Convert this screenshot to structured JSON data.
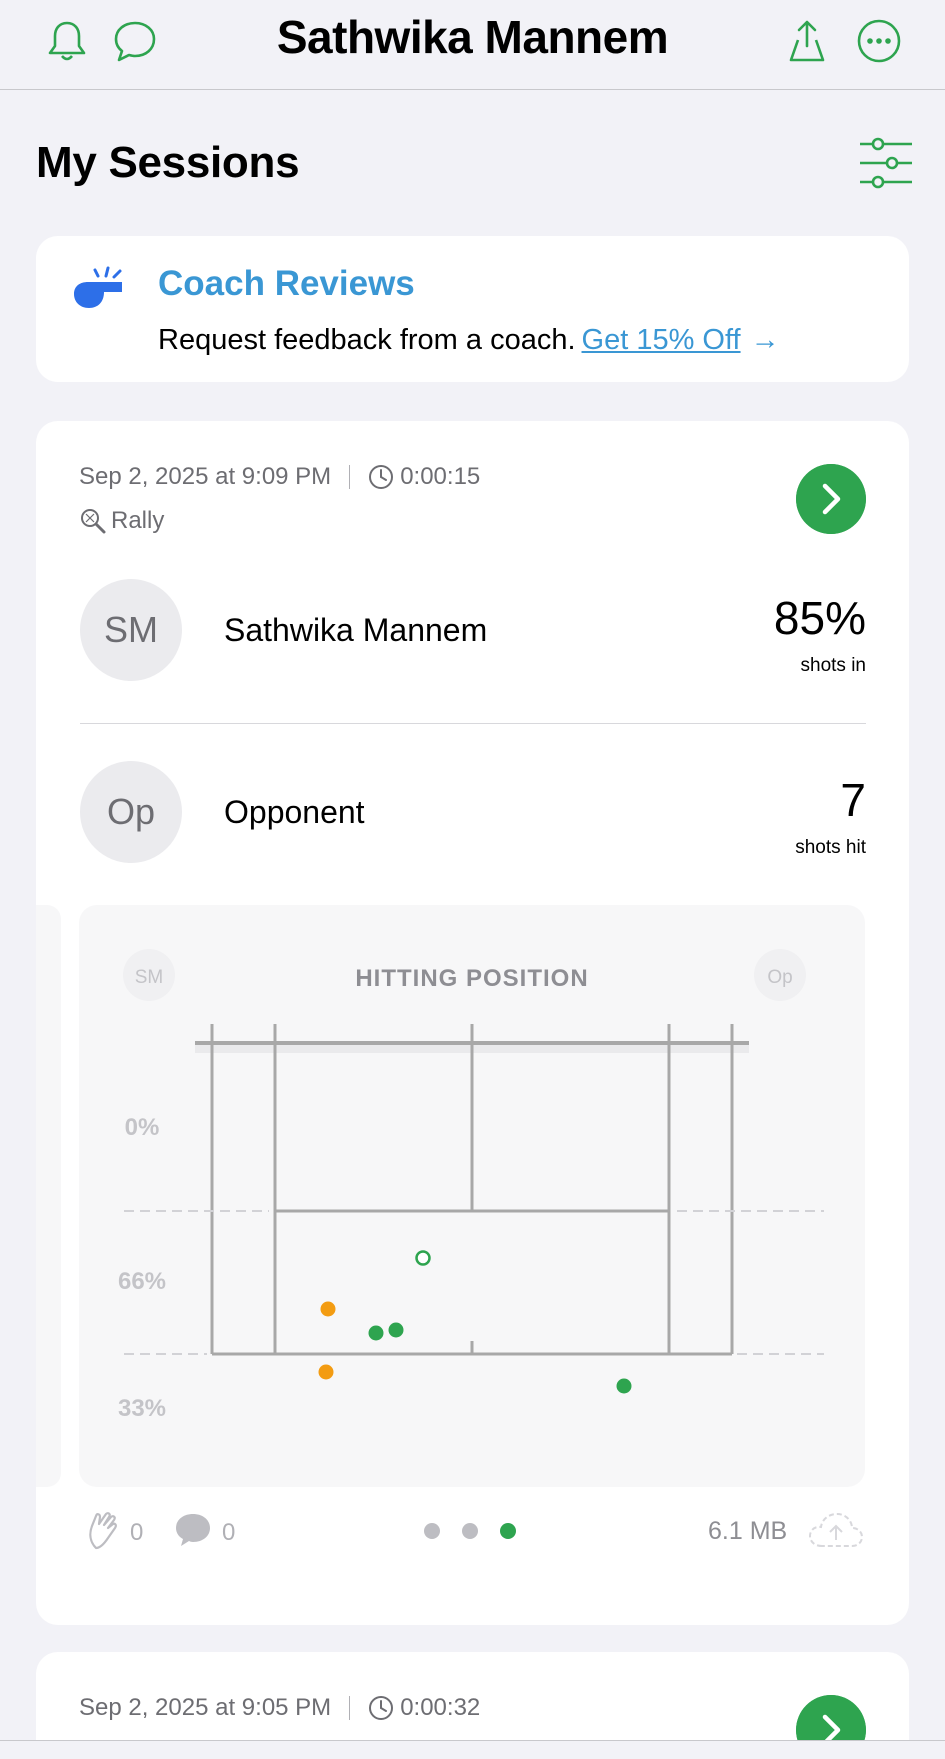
{
  "header": {
    "title": "Sathwika Mannem",
    "icons": [
      "bell-icon",
      "chat-bubble-icon",
      "share-icon",
      "more-icon"
    ]
  },
  "section": {
    "title": "My Sessions"
  },
  "coach": {
    "title": "Coach Reviews",
    "subtitle": "Request feedback from a coach.",
    "link": "Get 15% Off",
    "arrow": "→"
  },
  "session1": {
    "date": "Sep 2, 2025 at 9:09 PM",
    "duration": "0:00:15",
    "type": "Rally",
    "players": [
      {
        "initials": "SM",
        "name": "Sathwika Mannem",
        "stat": "85%",
        "stat_label": "shots in"
      },
      {
        "initials": "Op",
        "name": "Opponent",
        "stat": "7",
        "stat_label": "shots hit"
      }
    ],
    "chart": {
      "title": "HITTING POSITION",
      "left_badge": "SM",
      "right_badge": "Op",
      "zone_labels": [
        "0%",
        "66%",
        "33%"
      ]
    },
    "likes": "0",
    "comments": "0",
    "size": "6.1 MB",
    "page_dots": 3,
    "active_dot": 3
  },
  "session2": {
    "date": "Sep 2, 2025 at 9:05 PM",
    "duration": "0:00:32"
  },
  "colors": {
    "accent": "#2ea44f",
    "link": "#3a97d4",
    "orange": "#f39c12",
    "court_line": "#a8a8a8"
  }
}
